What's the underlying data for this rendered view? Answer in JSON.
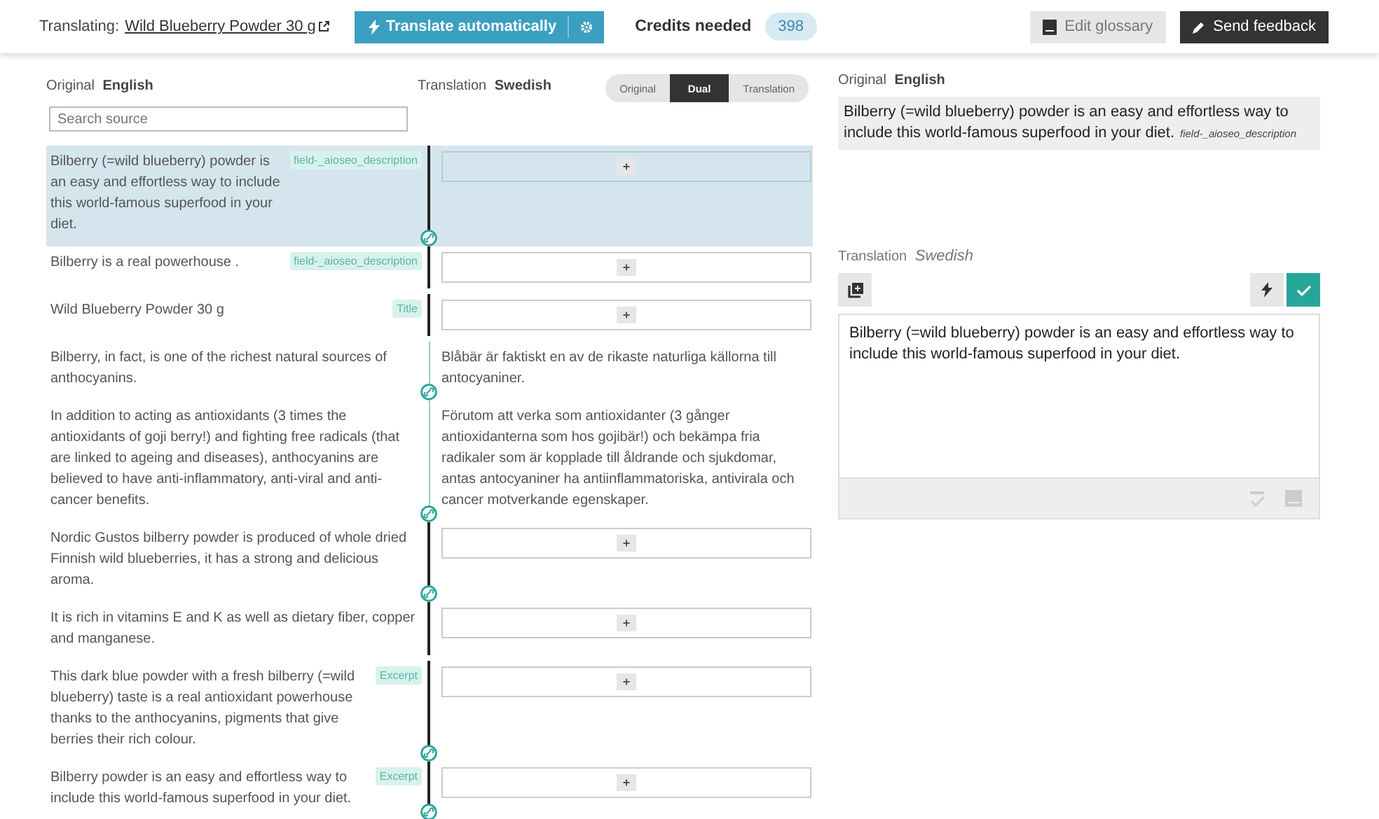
{
  "header": {
    "translating_label": "Translating:",
    "product_link": "Wild Blueberry Powder 30 g",
    "translate_button": "Translate automatically",
    "credits_label": "Credits needed",
    "credits": "398",
    "edit_glossary": "Edit glossary",
    "send_feedback": "Send feedback"
  },
  "editor": {
    "original_label": "Original",
    "original_lang": "English",
    "translation_label": "Translation",
    "translation_lang": "Swedish",
    "search_placeholder": "Search source",
    "view_modes": [
      {
        "label": "Original",
        "selected": false
      },
      {
        "label": "Dual",
        "selected": true
      },
      {
        "label": "Translation",
        "selected": false
      }
    ],
    "rows": [
      {
        "source": "Bilberry (=wild blueberry) powder is an easy and effortless way to include this world-famous superfood in your diet.",
        "tag": "field-_aioseo_description",
        "add_button": "+",
        "selected": true,
        "linked": true
      },
      {
        "source": "Bilberry is a real powerhouse .",
        "tag": "field-_aioseo_description",
        "add_button": "+",
        "selected": false,
        "linked": false
      },
      {
        "source": "Wild Blueberry Powder 30 g",
        "tag": "Title",
        "add_button": "+",
        "selected": false,
        "linked": false
      },
      {
        "source": "Bilberry, in fact, is one of the richest natural sources of anthocyanins.",
        "translation": "Blåbär är faktiskt en av de rikaste naturliga källorna till antocyaniner.",
        "selected": false,
        "linked": true
      },
      {
        "source": "In addition to acting as antioxidants (3 times the antioxidants of goji berry!) and fighting free radicals (that are linked to ageing and diseases), anthocyanins are believed to have anti-inflammatory, anti-viral and anti-cancer benefits.",
        "translation": "Förutom att verka som antioxidanter (3 gånger antioxidanterna som hos gojibär!) och bekämpa fria radikaler som är kopplade till åldrande och sjukdomar, antas antocyaniner ha antiinflammatoriska, antivirala och cancer motverkande egenskaper.",
        "selected": false,
        "linked": true
      },
      {
        "source": "Nordic Gustos bilberry powder is produced of whole dried Finnish wild blueberries, it has a strong and delicious aroma.",
        "add_button": "+",
        "selected": false,
        "linked": true
      },
      {
        "source": "It is rich in vitamins E and K as well as dietary fiber, copper and manganese.",
        "add_button": "+",
        "selected": false,
        "linked": false
      },
      {
        "source": "This dark blue powder with a fresh bilberry (=wild blueberry) taste is a real antioxidant powerhouse thanks to the anthocyanins, pigments that give berries their rich colour.",
        "tag": "Excerpt",
        "add_button": "+",
        "selected": false,
        "linked": true
      },
      {
        "source": "Bilberry powder is an easy and effortless way to include this world-famous superfood in your diet.",
        "tag": "Excerpt",
        "add_button": "+",
        "selected": false,
        "linked": true
      }
    ]
  },
  "detail": {
    "original_label": "Original",
    "original_lang": "English",
    "original_text": "Bilberry (=wild blueberry) powder is an easy and effortless way to include this world-famous superfood in your diet.",
    "original_tag": "field-_aioseo_description",
    "translation_label": "Translation",
    "translation_lang": "Swedish",
    "translation_text": "Bilberry (=wild blueberry) powder is an easy and effortless way to include this world-famous superfood in your diet."
  }
}
